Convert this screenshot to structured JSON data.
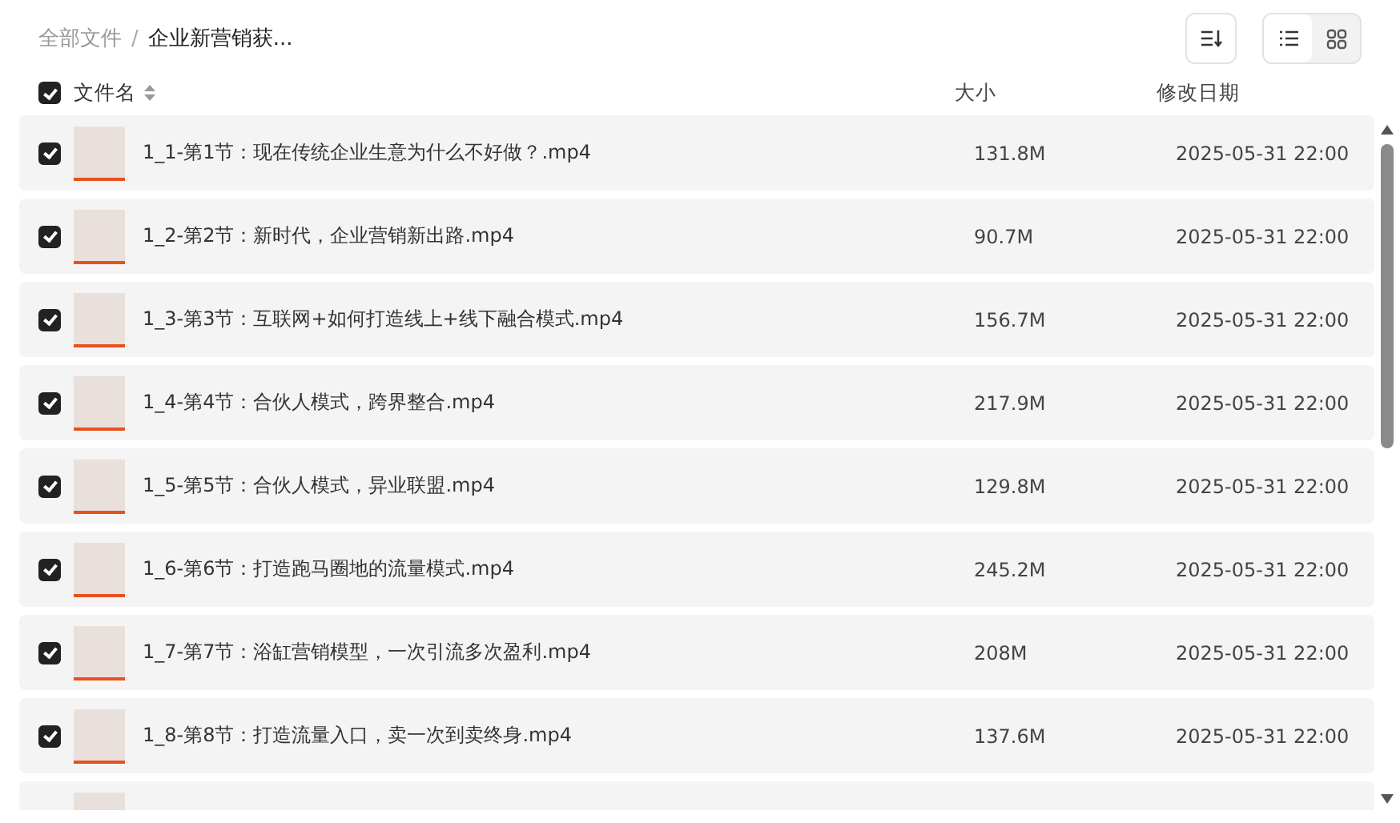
{
  "breadcrumb_separator": "/",
  "breadcrumb": [
    {
      "label": "全部文件",
      "current": false
    },
    {
      "label": "企业新营销获...",
      "current": true
    }
  ],
  "view_modes": [
    {
      "kind": "list",
      "selected": true
    },
    {
      "kind": "grid",
      "selected": false
    }
  ],
  "table": {
    "select_all": {
      "checked": true
    },
    "columns": [
      {
        "label": "文件名",
        "sortable": true
      },
      {
        "label": "大小",
        "sortable": false
      },
      {
        "label": "修改日期",
        "sortable": false
      }
    ],
    "rows": [
      {
        "name": "1_1-第1节：现在传统企业生意为什么不好做？.mp4",
        "size": "131.8M",
        "modified": "2025-05-31 22:00",
        "checked": true
      },
      {
        "name": "1_2-第2节：新时代，企业营销新出路.mp4",
        "size": "90.7M",
        "modified": "2025-05-31 22:00",
        "checked": true
      },
      {
        "name": "1_3-第3节：互联网+如何打造线上+线下融合模式.mp4",
        "size": "156.7M",
        "modified": "2025-05-31 22:00",
        "checked": true
      },
      {
        "name": "1_4-第4节：合伙人模式，跨界整合.mp4",
        "size": "217.9M",
        "modified": "2025-05-31 22:00",
        "checked": true
      },
      {
        "name": "1_5-第5节：合伙人模式，异业联盟.mp4",
        "size": "129.8M",
        "modified": "2025-05-31 22:00",
        "checked": true
      },
      {
        "name": "1_6-第6节：打造跑马圈地的流量模式.mp4",
        "size": "245.2M",
        "modified": "2025-05-31 22:00",
        "checked": true
      },
      {
        "name": "1_7-第7节：浴缸营销模型，一次引流多次盈利.mp4",
        "size": "208M",
        "modified": "2025-05-31 22:00",
        "checked": true
      },
      {
        "name": "1_8-第8节：打造流量入口，卖一次到卖终身.mp4",
        "size": "137.6M",
        "modified": "2025-05-31 22:00",
        "checked": true
      }
    ]
  }
}
